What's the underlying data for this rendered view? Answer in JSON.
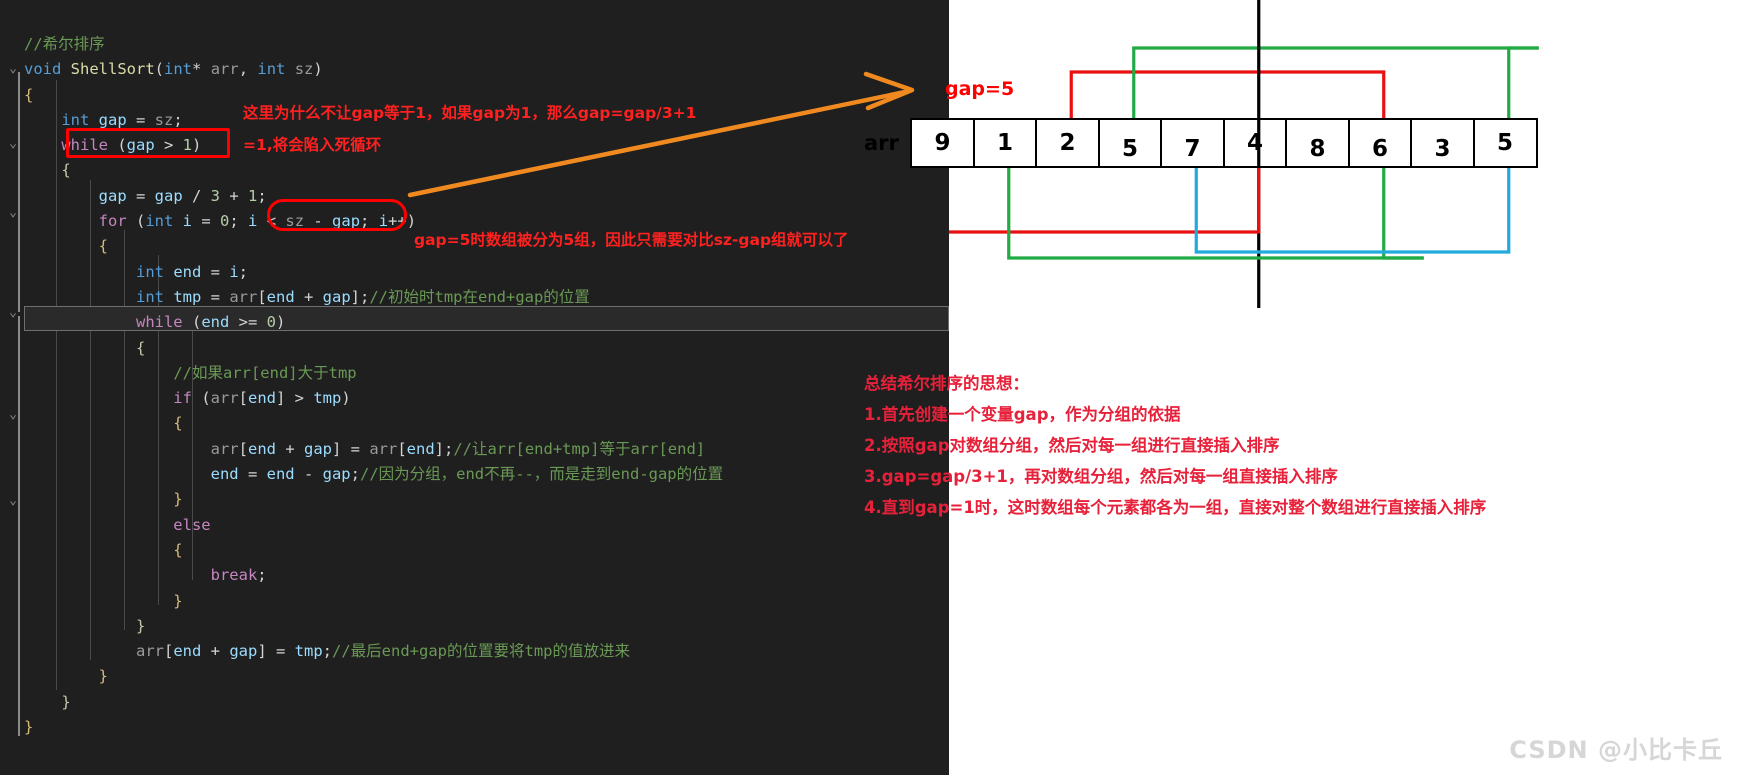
{
  "editor": {
    "code_lines": [
      [
        {
          "t": "//希尔排序",
          "c": "cmt"
        }
      ],
      [
        {
          "t": "void ",
          "c": "type"
        },
        {
          "t": "ShellSort",
          "c": "fn"
        },
        {
          "t": "(",
          "c": "punct"
        },
        {
          "t": "int",
          "c": "type"
        },
        {
          "t": "* ",
          "c": "punct"
        },
        {
          "t": "arr",
          "c": "dim"
        },
        {
          "t": ", ",
          "c": "punct"
        },
        {
          "t": "int",
          "c": "type"
        },
        {
          "t": " sz",
          "c": "dim"
        },
        {
          "t": ")",
          "c": "punct"
        }
      ],
      [
        {
          "t": "{",
          "c": "brace1"
        }
      ],
      [
        {
          "t": "    int",
          "c": "type"
        },
        {
          "t": " gap",
          "c": "var"
        },
        {
          "t": " = ",
          "c": "punct"
        },
        {
          "t": "sz",
          "c": "dim"
        },
        {
          "t": ";",
          "c": "punct"
        }
      ],
      [
        {
          "t": "    while",
          "c": "kw"
        },
        {
          "t": " (",
          "c": "punct"
        },
        {
          "t": "gap",
          "c": "var"
        },
        {
          "t": " > ",
          "c": "punct"
        },
        {
          "t": "1",
          "c": "num"
        },
        {
          "t": ")",
          "c": "punct"
        }
      ],
      [
        {
          "t": "    {",
          "c": "brace2"
        }
      ],
      [
        {
          "t": "        gap",
          "c": "var"
        },
        {
          "t": " = ",
          "c": "punct"
        },
        {
          "t": "gap",
          "c": "var"
        },
        {
          "t": " / ",
          "c": "punct"
        },
        {
          "t": "3",
          "c": "num"
        },
        {
          "t": " + ",
          "c": "punct"
        },
        {
          "t": "1",
          "c": "num"
        },
        {
          "t": ";",
          "c": "punct"
        }
      ],
      [
        {
          "t": "        for",
          "c": "kw"
        },
        {
          "t": " (",
          "c": "punct"
        },
        {
          "t": "int",
          "c": "type"
        },
        {
          "t": " i",
          "c": "var"
        },
        {
          "t": " = ",
          "c": "punct"
        },
        {
          "t": "0",
          "c": "num"
        },
        {
          "t": "; ",
          "c": "punct"
        },
        {
          "t": "i",
          "c": "var"
        },
        {
          "t": " < ",
          "c": "punct"
        },
        {
          "t": "sz",
          "c": "dim"
        },
        {
          "t": " - ",
          "c": "punct"
        },
        {
          "t": "gap",
          "c": "var"
        },
        {
          "t": "; ",
          "c": "punct"
        },
        {
          "t": "i",
          "c": "var"
        },
        {
          "t": "++)",
          "c": "punct"
        }
      ],
      [
        {
          "t": "        {",
          "c": "brace1"
        }
      ],
      [
        {
          "t": "            int",
          "c": "type"
        },
        {
          "t": " end",
          "c": "var"
        },
        {
          "t": " = ",
          "c": "punct"
        },
        {
          "t": "i",
          "c": "var"
        },
        {
          "t": ";",
          "c": "punct"
        }
      ],
      [
        {
          "t": "            int",
          "c": "type"
        },
        {
          "t": " tmp",
          "c": "var"
        },
        {
          "t": " = ",
          "c": "punct"
        },
        {
          "t": "arr",
          "c": "dim"
        },
        {
          "t": "[",
          "c": "punct"
        },
        {
          "t": "end",
          "c": "var"
        },
        {
          "t": " + ",
          "c": "punct"
        },
        {
          "t": "gap",
          "c": "var"
        },
        {
          "t": "];",
          "c": "punct"
        },
        {
          "t": "//初始时tmp在end+gap的位置",
          "c": "cmt"
        }
      ],
      [
        {
          "t": "            while",
          "c": "kw"
        },
        {
          "t": " (",
          "c": "punct"
        },
        {
          "t": "end",
          "c": "var"
        },
        {
          "t": " >= ",
          "c": "punct"
        },
        {
          "t": "0",
          "c": "num"
        },
        {
          "t": ")",
          "c": "punct"
        }
      ],
      [
        {
          "t": "            {",
          "c": "brace2"
        }
      ],
      [
        {
          "t": "                ",
          "c": "punct"
        },
        {
          "t": "//如果arr[end]大于tmp",
          "c": "cmt"
        }
      ],
      [
        {
          "t": "                if",
          "c": "kw"
        },
        {
          "t": " (",
          "c": "punct"
        },
        {
          "t": "arr",
          "c": "dim"
        },
        {
          "t": "[",
          "c": "punct"
        },
        {
          "t": "end",
          "c": "var"
        },
        {
          "t": "] > ",
          "c": "punct"
        },
        {
          "t": "tmp",
          "c": "var"
        },
        {
          "t": ")",
          "c": "punct"
        }
      ],
      [
        {
          "t": "                {",
          "c": "brace1"
        }
      ],
      [
        {
          "t": "                    arr",
          "c": "dim"
        },
        {
          "t": "[",
          "c": "punct"
        },
        {
          "t": "end",
          "c": "var"
        },
        {
          "t": " + ",
          "c": "punct"
        },
        {
          "t": "gap",
          "c": "var"
        },
        {
          "t": "] = ",
          "c": "punct"
        },
        {
          "t": "arr",
          "c": "dim"
        },
        {
          "t": "[",
          "c": "punct"
        },
        {
          "t": "end",
          "c": "var"
        },
        {
          "t": "];",
          "c": "punct"
        },
        {
          "t": "//让arr[end+tmp]等于arr[end]",
          "c": "cmt"
        }
      ],
      [
        {
          "t": "                    end",
          "c": "var"
        },
        {
          "t": " = ",
          "c": "punct"
        },
        {
          "t": "end",
          "c": "var"
        },
        {
          "t": " - ",
          "c": "punct"
        },
        {
          "t": "gap",
          "c": "var"
        },
        {
          "t": ";",
          "c": "punct"
        },
        {
          "t": "//因为分组，end不再--，而是走到end-gap的位置",
          "c": "cmt"
        }
      ],
      [
        {
          "t": "                }",
          "c": "brace1"
        }
      ],
      [
        {
          "t": "                else",
          "c": "kw"
        }
      ],
      [
        {
          "t": "                {",
          "c": "brace1"
        }
      ],
      [
        {
          "t": "                    break",
          "c": "kw"
        },
        {
          "t": ";",
          "c": "punct"
        }
      ],
      [
        {
          "t": "                }",
          "c": "brace1"
        }
      ],
      [
        {
          "t": "            }",
          "c": "brace2"
        }
      ],
      [
        {
          "t": "            arr",
          "c": "dim"
        },
        {
          "t": "[",
          "c": "punct"
        },
        {
          "t": "end",
          "c": "var"
        },
        {
          "t": " + ",
          "c": "punct"
        },
        {
          "t": "gap",
          "c": "var"
        },
        {
          "t": "] = ",
          "c": "punct"
        },
        {
          "t": "tmp",
          "c": "var"
        },
        {
          "t": ";",
          "c": "punct"
        },
        {
          "t": "//最后end+gap的位置要将tmp的值放进来",
          "c": "cmt"
        }
      ],
      [
        {
          "t": "        }",
          "c": "brace1"
        }
      ],
      [
        {
          "t": "    }",
          "c": "brace2"
        }
      ],
      [
        {
          "t": "}",
          "c": "brace1"
        }
      ]
    ],
    "annotations": {
      "note1_line1": "这里为什么不让gap等于1，如果gap为1，那么gap=gap/3+1",
      "note1_line2": "=1,将会陷入死循环",
      "note2": "gap=5时数组被分为5组，因此只需要对比sz-gap组就可以了"
    }
  },
  "diagram": {
    "array_label": "arr",
    "gap_label": "gap=5",
    "array_values": [
      "9",
      "1",
      "2",
      "5",
      "7",
      "4",
      "8",
      "6",
      "3",
      "5"
    ],
    "colors": {
      "group_red": "#e81010",
      "group_green": "#22aa44",
      "group_blue": "#22aadd",
      "group_black": "#000000",
      "annotation_red": "#ff0000",
      "arrow_orange": "#f08a20"
    }
  },
  "summary": {
    "title": "总结希尔排序的思想：",
    "items": [
      "1.首先创建一个变量gap，作为分组的依据",
      "2.按照gap对数组分组，然后对每一组进行直接插入排序",
      "3.gap=gap/3+1，再对数组分组，然后对每一组直接插入排序",
      "4.直到gap=1时，这时数组每个元素都各为一组，直接对整个数组进行直接插入排序"
    ]
  },
  "watermark": "CSDN @小比卡丘"
}
